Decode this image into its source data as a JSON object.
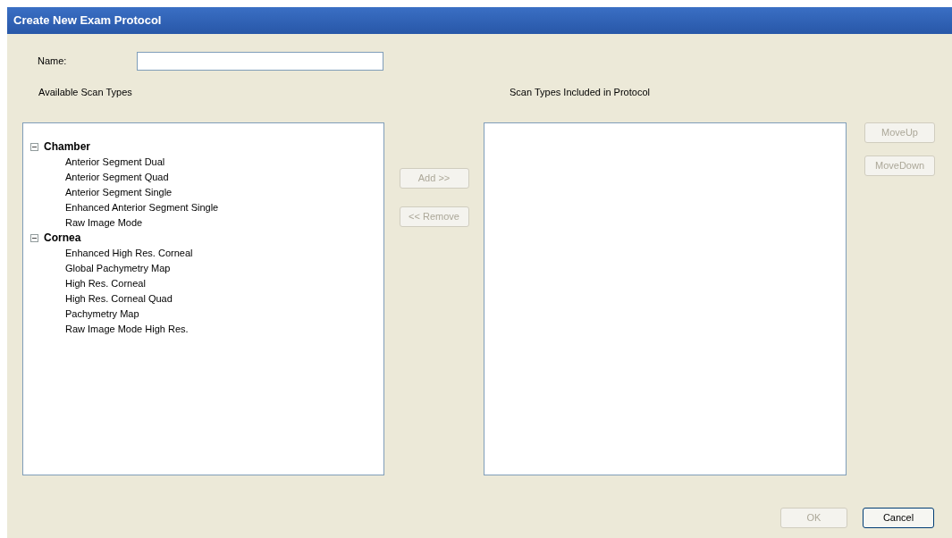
{
  "window": {
    "title": "Create New Exam Protocol"
  },
  "name_field": {
    "label": "Name:"
  },
  "available": {
    "heading": "Available Scan Types",
    "groups": [
      {
        "label": "Chamber",
        "expanded": true,
        "children": [
          {
            "label": "Anterior Segment Dual"
          },
          {
            "label": "Anterior Segment Quad"
          },
          {
            "label": "Anterior Segment Single"
          },
          {
            "label": "Enhanced Anterior Segment Single"
          },
          {
            "label": "Raw Image Mode"
          }
        ]
      },
      {
        "label": "Cornea",
        "expanded": true,
        "children": [
          {
            "label": "Enhanced High Res. Corneal"
          },
          {
            "label": "Global Pachymetry Map"
          },
          {
            "label": "High Res. Corneal"
          },
          {
            "label": "High Res. Corneal Quad"
          },
          {
            "label": "Pachymetry Map"
          },
          {
            "label": "Raw Image Mode High Res."
          }
        ]
      }
    ]
  },
  "transfer_buttons": [
    {
      "label": "Add >>",
      "disabled": true
    },
    {
      "label": "<< Remove",
      "disabled": true
    }
  ],
  "included": {
    "heading": "Scan Types Included in Protocol"
  },
  "order_buttons": [
    {
      "label": "MoveUp",
      "disabled": true
    },
    {
      "label": "MoveDown",
      "disabled": true
    }
  ],
  "dialog_buttons": [
    {
      "label": "OK",
      "disabled": true
    },
    {
      "label": "Cancel",
      "disabled": false
    }
  ]
}
